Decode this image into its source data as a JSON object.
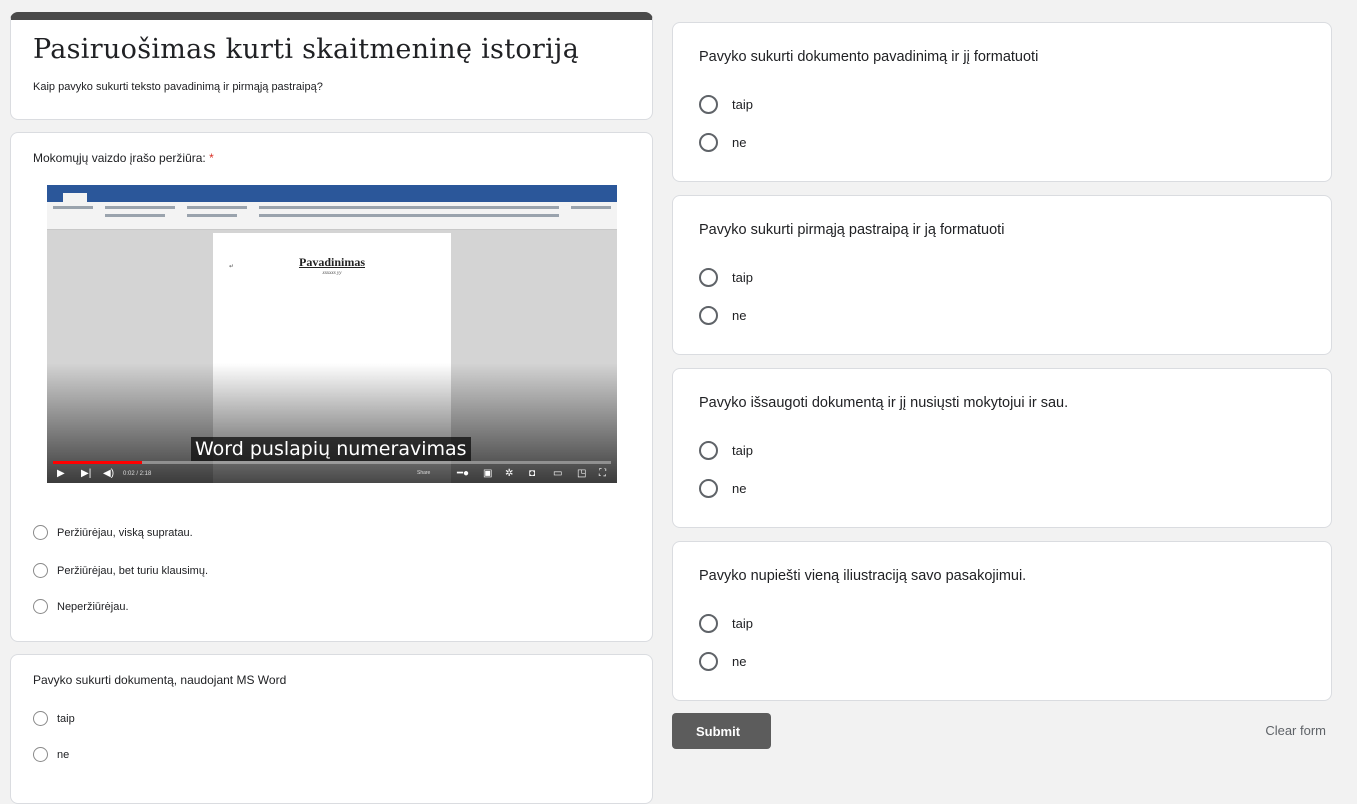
{
  "form": {
    "title": "Pasiruošimas kurti skaitmeninę istoriją",
    "description": "Kaip pavyko sukurti teksto pavadinimą ir pirmąją pastraipą?"
  },
  "video_question": {
    "label": "Mokomųjų vaizdo įrašo peržiūra:",
    "required_mark": "*",
    "video": {
      "doc_heading": "Pavadinimas",
      "doc_subheading": "xxxxxx yy",
      "caption": "Word puslapių numeravimas",
      "timecode": "0:02 / 2:18",
      "share_label": "Share",
      "progress": 0.16,
      "icons": [
        "play-icon",
        "next-icon",
        "volume-icon",
        "autoplay-toggle-icon",
        "subtitles-icon",
        "settings-icon",
        "miniplayer-icon",
        "theater-icon",
        "cast-icon",
        "fullscreen-icon"
      ]
    },
    "options": [
      "Peržiūrėjau, viską supratau.",
      "Peržiūrėjau, bet turiu klausimų.",
      "Neperžiūrėjau."
    ]
  },
  "questions": [
    {
      "text": "Pavyko sukurti dokumentą, naudojant MS Word",
      "options": [
        "taip",
        "ne"
      ]
    },
    {
      "text": "Pavyko sukurti dokumento pavadinimą ir jį formatuoti",
      "options": [
        "taip",
        "ne"
      ]
    },
    {
      "text": "Pavyko sukurti pirmąją pastraipą ir ją formatuoti",
      "options": [
        "taip",
        "ne"
      ]
    },
    {
      "text": "Pavyko išsaugoti dokumentą ir jį nusiųsti mokytojui ir sau.",
      "options": [
        "taip",
        "ne"
      ]
    },
    {
      "text": "Pavyko nupiešti vieną iliustraciją savo pasakojimui.",
      "options": [
        "taip",
        "ne"
      ]
    }
  ],
  "actions": {
    "submit": "Submit",
    "clear": "Clear form"
  },
  "colors": {
    "header_bar": "#4a4a4a",
    "submit_bg": "#5c5c5c",
    "required": "#d93025",
    "word_blue": "#2b579a",
    "progress_red": "#ff0000"
  }
}
